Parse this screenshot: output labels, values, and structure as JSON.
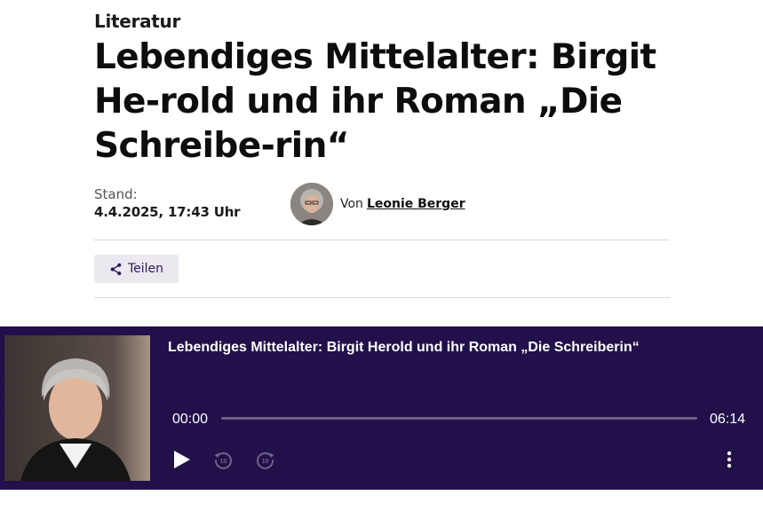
{
  "article": {
    "kicker": "Literatur",
    "headline": "Lebendiges Mittelalter: Birgit He-rold und ihr Roman „Die Schreibe-rin“",
    "stand_label": "Stand:",
    "stand_date": "4.4.2025, 17:43 Uhr",
    "author_prefix": "Von",
    "author_name": "Leonie Berger",
    "share_label": "Teilen"
  },
  "player": {
    "title": "Lebendiges Mittelalter: Birgit Herold und ihr Roman „Die Schreiberin“",
    "current_time": "00:00",
    "duration": "06:14",
    "progress": 0,
    "skip_back_seconds": "10",
    "skip_forward_seconds": "10",
    "background_color": "#22104a"
  },
  "icons": {
    "share": "share-icon",
    "play": "play-icon",
    "rewind": "rewind-10-icon",
    "forward": "forward-10-icon",
    "more": "more-vertical-icon"
  }
}
